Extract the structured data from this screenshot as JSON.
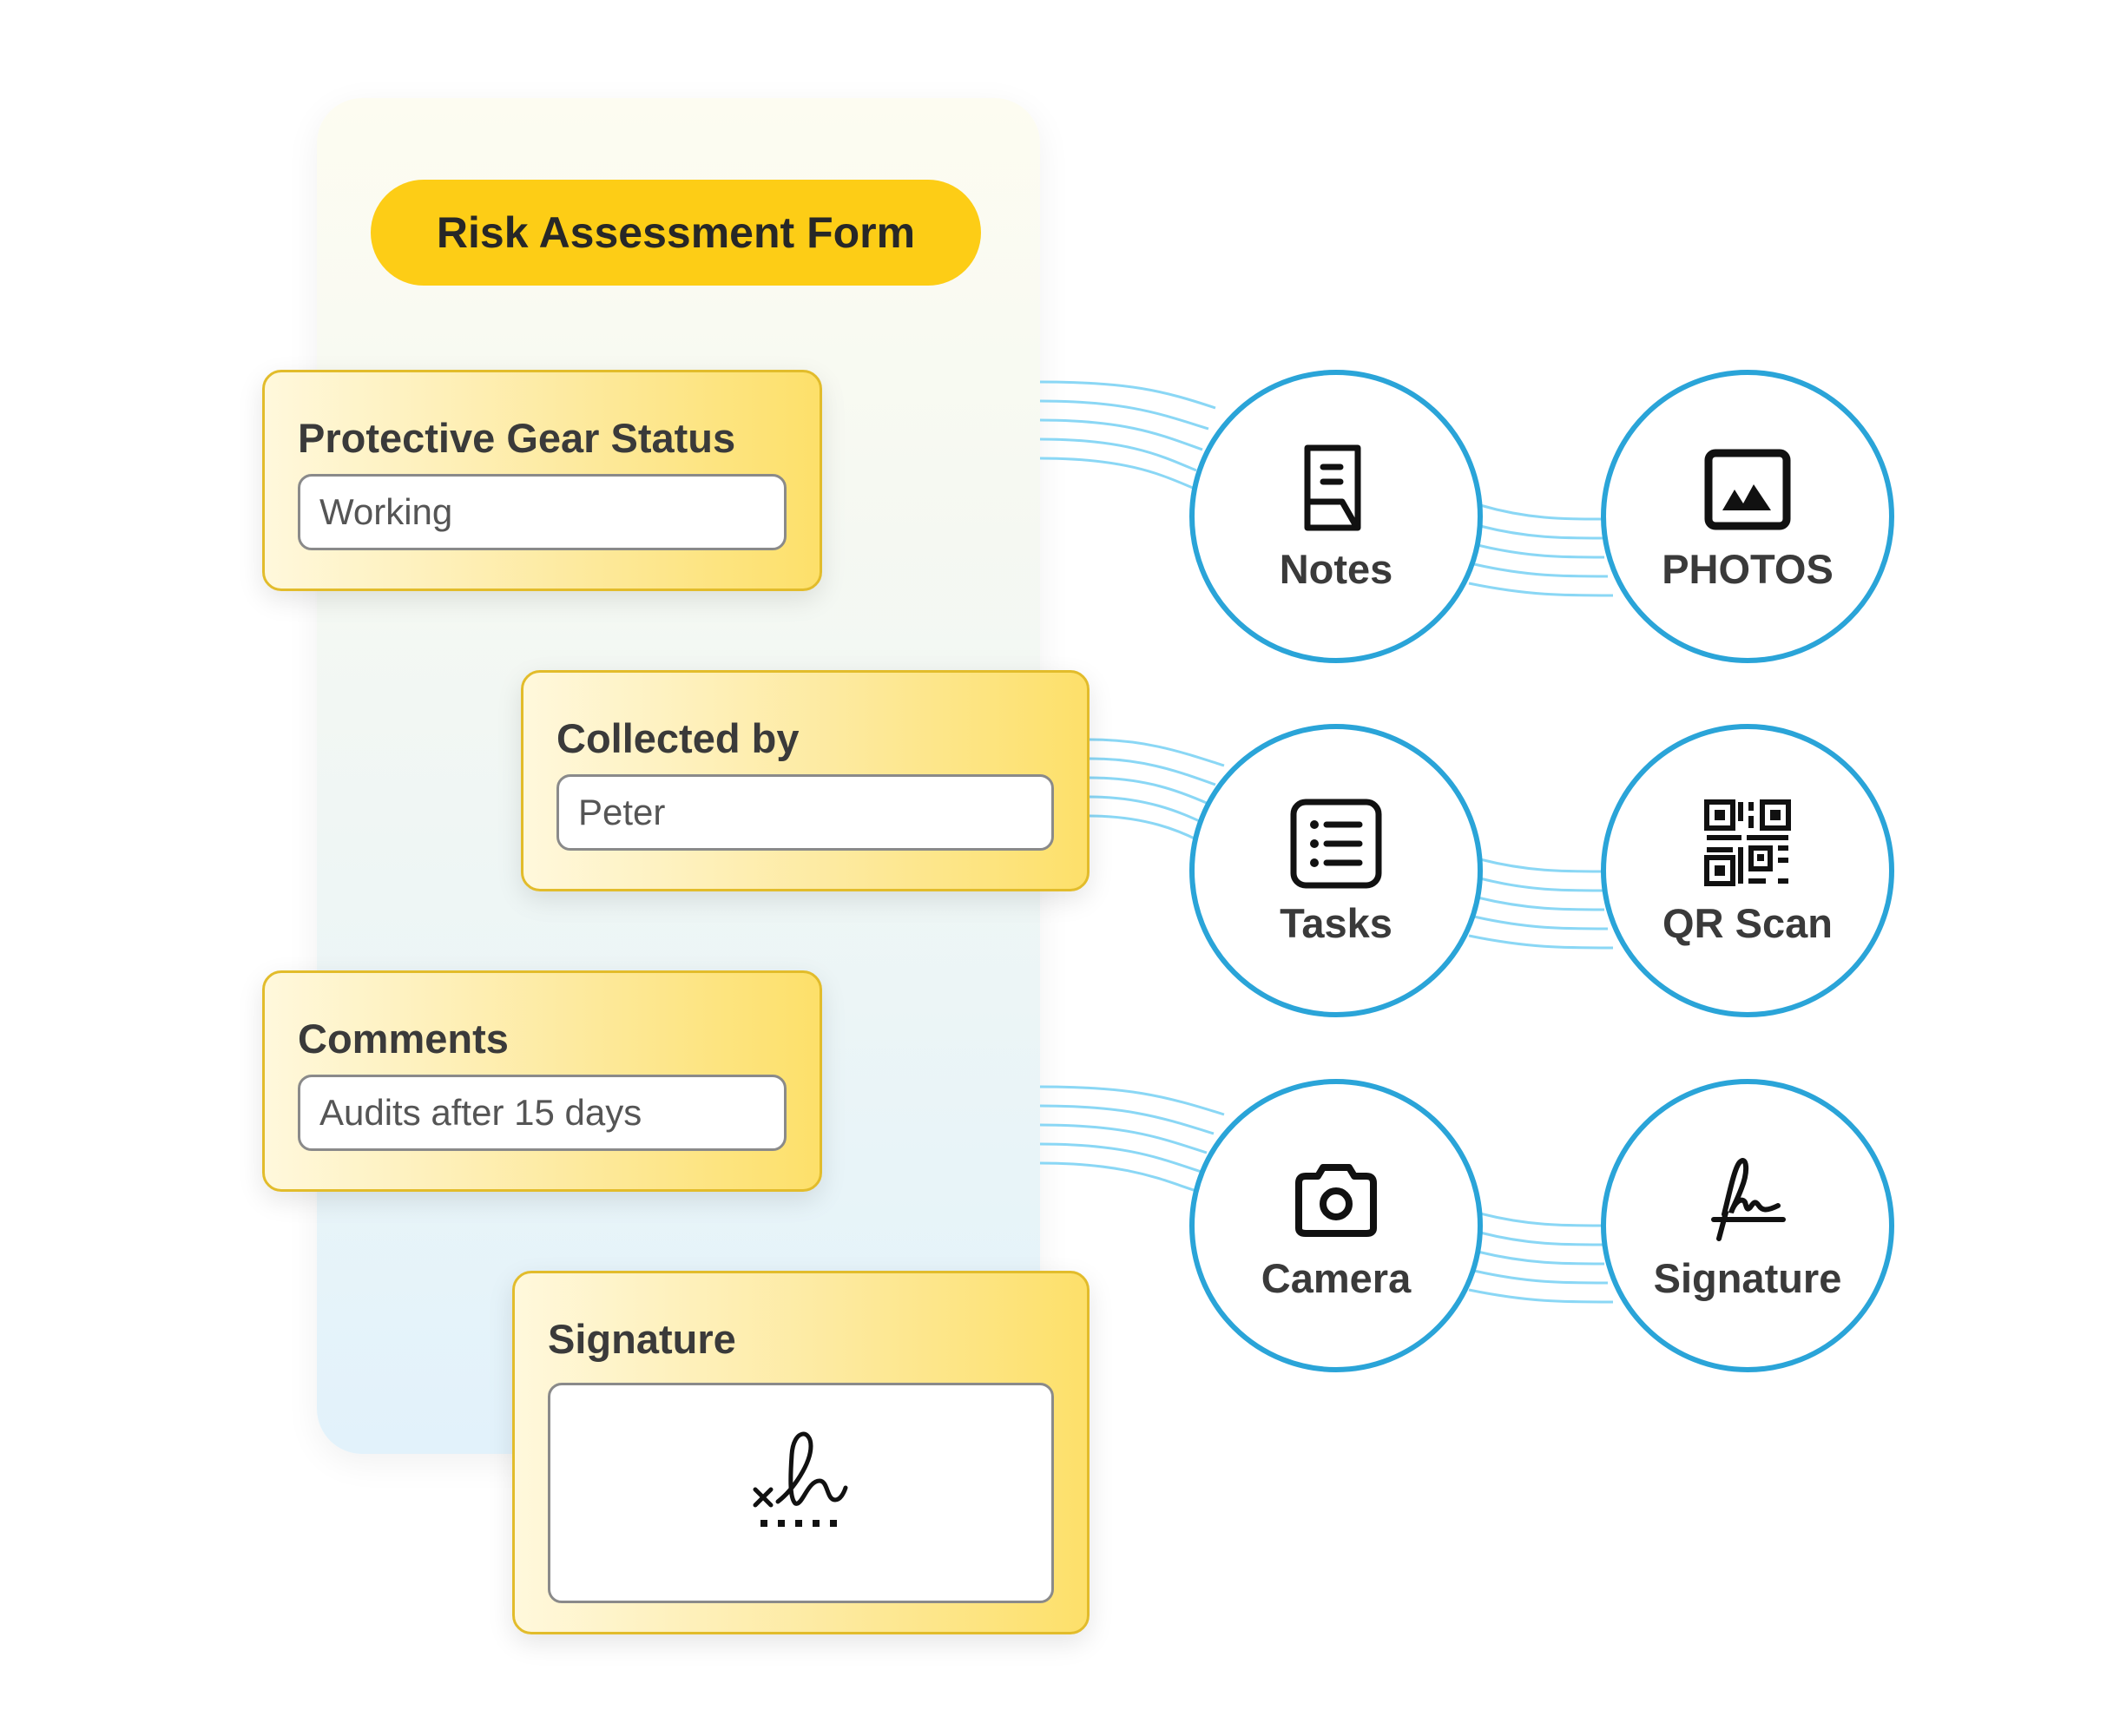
{
  "form": {
    "title": "Risk Assessment Form",
    "fields": [
      {
        "label": "Protective Gear Status",
        "value": "Working"
      },
      {
        "label": "Collected by",
        "value": "Peter"
      },
      {
        "label": "Comments",
        "value": "Audits after 15 days"
      },
      {
        "label": "Signature",
        "value": "signature-drawing"
      }
    ]
  },
  "features": [
    {
      "label": "Notes",
      "icon": "notes-icon"
    },
    {
      "label": "PHOTOS",
      "icon": "image-icon"
    },
    {
      "label": "Tasks",
      "icon": "list-icon"
    },
    {
      "label": "QR Scan",
      "icon": "qr-code-icon"
    },
    {
      "label": "Camera",
      "icon": "camera-icon"
    },
    {
      "label": "Signature",
      "icon": "signature-icon"
    }
  ],
  "colors": {
    "accent_yellow": "#fdcd16",
    "card_border": "#e2bc2b",
    "circle_blue": "#2aa4d8",
    "connector_blue": "#8ad7f5"
  }
}
